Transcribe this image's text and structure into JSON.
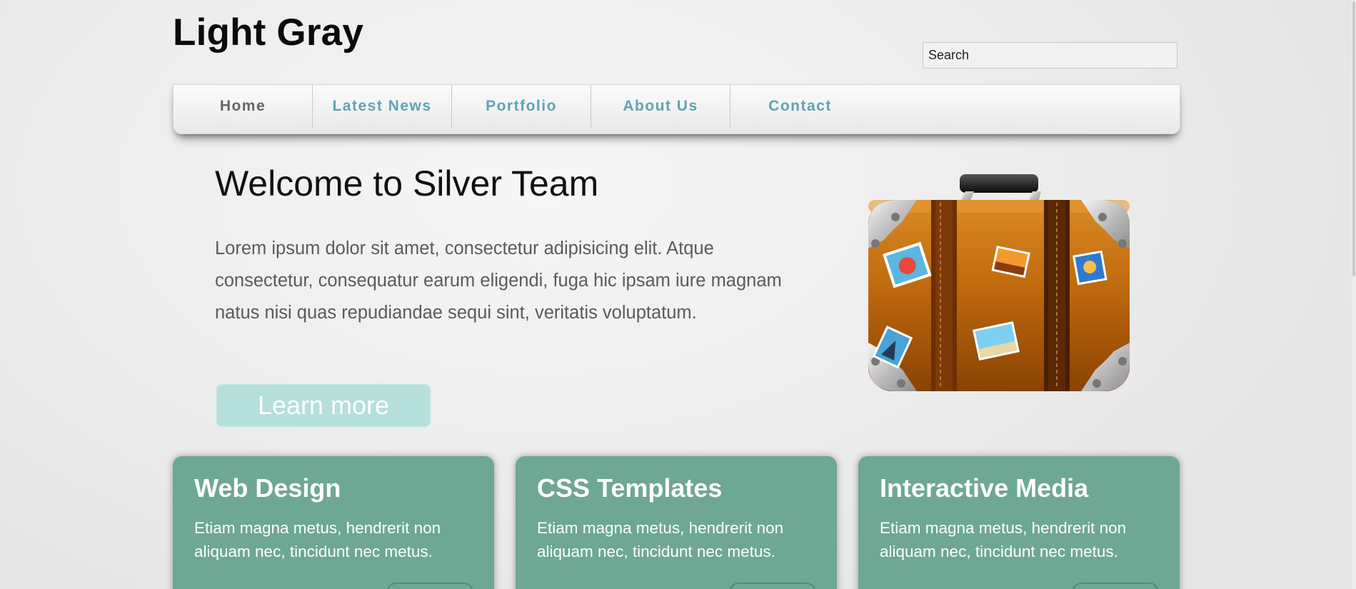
{
  "header": {
    "site_title": "Light Gray",
    "search_placeholder": "Search"
  },
  "nav": {
    "items": [
      {
        "label": "Home",
        "active": true
      },
      {
        "label": "Latest News",
        "active": false
      },
      {
        "label": "Portfolio",
        "active": false
      },
      {
        "label": "About Us",
        "active": false
      },
      {
        "label": "Contact",
        "active": false
      }
    ]
  },
  "hero": {
    "title": "Welcome to Silver Team",
    "text": "Lorem ipsum dolor sit amet, consectetur adipisicing elit. Atque consectetur, consequatur earum eligendi, fuga hic ipsam iure magnam natus nisi quas repudiandae sequi sint, veritatis voluptatum.",
    "button_label": "Learn more",
    "image_icon": "suitcase-icon"
  },
  "cards": [
    {
      "title": "Web Design",
      "text": "Etiam magna metus, hendrerit non aliquam nec, tincidunt nec metus."
    },
    {
      "title": "CSS Templates",
      "text": "Etiam magna metus, hendrerit non aliquam nec, tincidunt nec metus."
    },
    {
      "title": "Interactive Media",
      "text": "Etiam magna metus, hendrerit non aliquam nec, tincidunt nec metus."
    }
  ],
  "colors": {
    "accent_link": "#5fa3b4",
    "card_green": "#6ea794",
    "button_teal": "#b5e0dc"
  }
}
